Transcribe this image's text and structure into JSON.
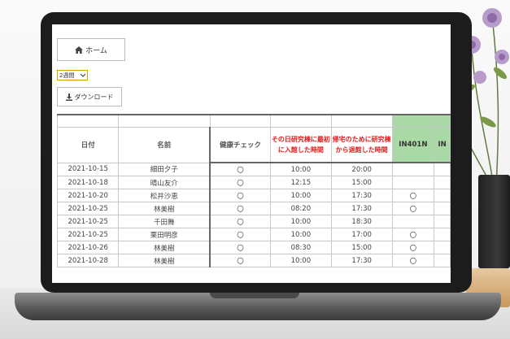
{
  "toolbar": {
    "home_label": "ホーム",
    "period_value": "2週間",
    "download_label": "ダウンロード"
  },
  "table": {
    "headers": {
      "date": "日付",
      "name": "名前",
      "health": "健康チェック",
      "first_entry": "その日研究棟に最初に入館した時間",
      "last_exit": "帰宅のために研究棟から退館した時間",
      "room": "IN401N",
      "room_partial": "IN"
    },
    "rows": [
      {
        "date": "2021-10-15",
        "name": "細田夕子",
        "health": "〇",
        "in": "10:00",
        "out": "20:00",
        "room": ""
      },
      {
        "date": "2021-10-18",
        "name": "晴山友介",
        "health": "〇",
        "in": "12:15",
        "out": "15:00",
        "room": ""
      },
      {
        "date": "2021-10-20",
        "name": "松井沙恵",
        "health": "〇",
        "in": "10:00",
        "out": "17:30",
        "room": "〇"
      },
      {
        "date": "2021-10-25",
        "name": "林美樹",
        "health": "〇",
        "in": "08:20",
        "out": "17:30",
        "room": "〇"
      },
      {
        "date": "2021-10-25",
        "name": "千田舞",
        "health": "〇",
        "in": "10:00",
        "out": "18:30",
        "room": ""
      },
      {
        "date": "2021-10-25",
        "name": "栗田明彦",
        "health": "〇",
        "in": "10:00",
        "out": "17:00",
        "room": "〇"
      },
      {
        "date": "2021-10-26",
        "name": "林美樹",
        "health": "〇",
        "in": "08:30",
        "out": "15:00",
        "room": "〇"
      },
      {
        "date": "2021-10-28",
        "name": "林美樹",
        "health": "〇",
        "in": "10:00",
        "out": "17:30",
        "room": "〇"
      }
    ]
  },
  "colors": {
    "header_red": "#e81818",
    "room_header_green": "#a9d9a4",
    "select_border": "#e0a000"
  },
  "icons": {
    "home": "home-icon",
    "download": "download-icon",
    "dropdown": "chevron-down-icon"
  }
}
